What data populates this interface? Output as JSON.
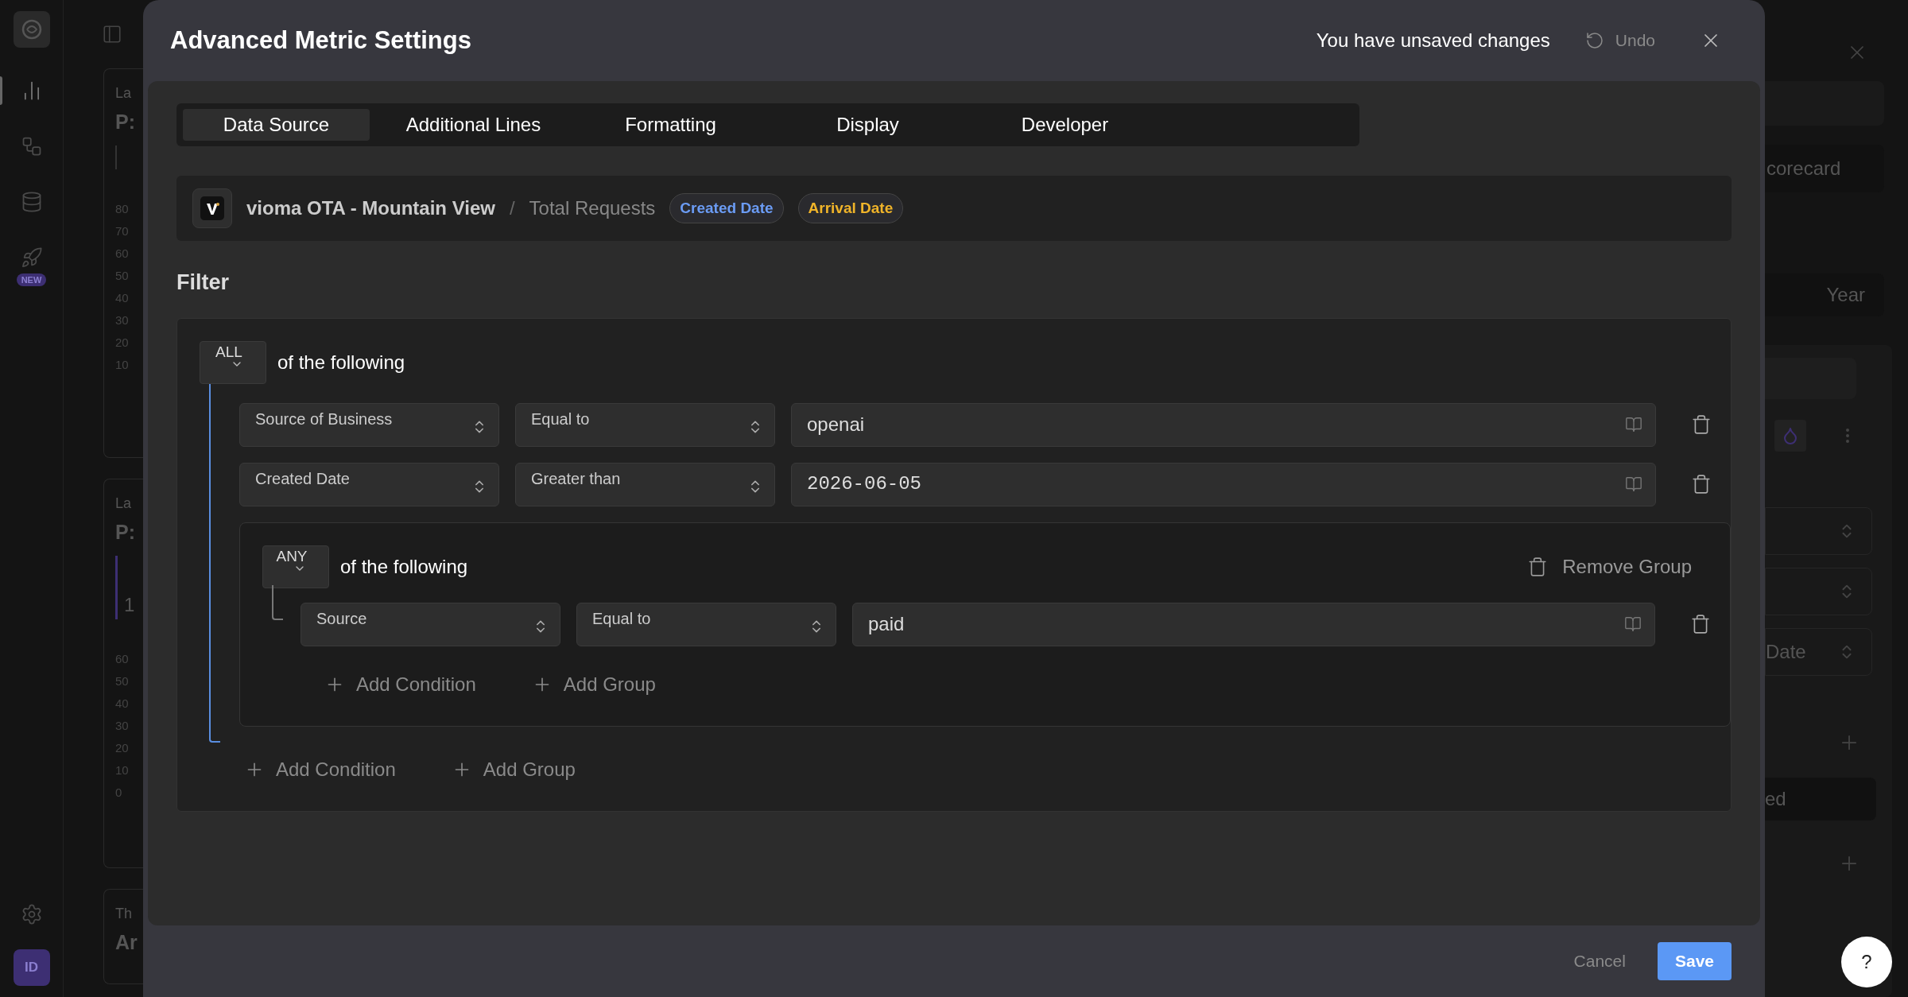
{
  "app_sidebar": {
    "items": [
      {
        "kind": "chart",
        "selected": true
      },
      {
        "kind": "flow",
        "selected": false
      },
      {
        "kind": "database",
        "selected": false
      },
      {
        "kind": "rocket",
        "selected": false,
        "badge": "NEW"
      }
    ],
    "avatar": "ID"
  },
  "background_left": {
    "cards": [
      {
        "label": "La",
        "value": "P:",
        "accent": false,
        "ticks": [
          "80",
          "70",
          "60",
          "50",
          "40",
          "30",
          "20",
          "10"
        ]
      },
      {
        "label": "La",
        "value": "P:",
        "accent": true,
        "accent_value": "1",
        "ticks": [
          "60",
          "50",
          "40",
          "30",
          "20",
          "10",
          "0"
        ]
      },
      {
        "label": "Th",
        "value": "Ar",
        "accent": false
      }
    ]
  },
  "background_right": {
    "button": "corecard",
    "period": "Year",
    "select_value": "Date",
    "status": "ed"
  },
  "dialog": {
    "title": "Advanced Metric Settings",
    "unsaved_notice": "You have unsaved changes",
    "undo": "Undo",
    "tabs": [
      {
        "label": "Data Source",
        "selected": true
      },
      {
        "label": "Additional Lines",
        "selected": false
      },
      {
        "label": "Formatting",
        "selected": false
      },
      {
        "label": "Display",
        "selected": false
      },
      {
        "label": "Developer",
        "selected": false
      }
    ],
    "breadcrumb": {
      "source": "vioma OTA - Mountain View",
      "separator": "/",
      "metric": "Total Requests",
      "tags": [
        {
          "label": "Created Date",
          "color": "#6b9cf5"
        },
        {
          "label": "Arrival Date",
          "color": "#f0b429"
        }
      ]
    },
    "filter": {
      "heading": "Filter",
      "mode": "ALL",
      "suffix": "of the following",
      "items": [
        {
          "kind": "condition",
          "field": "Source of Business",
          "operator": "Equal to",
          "value": "openai",
          "monospace": false
        },
        {
          "kind": "condition",
          "field": "Created Date",
          "operator": "Greater than",
          "value": "2026-06-05",
          "monospace": true
        },
        {
          "kind": "group",
          "mode": "ANY",
          "suffix": "of the following",
          "remove": "Remove Group",
          "items": [
            {
              "kind": "condition",
              "field": "Source",
              "operator": "Equal to",
              "value": "paid",
              "monospace": false
            }
          ],
          "actions": [
            "Add Condition",
            "Add Group"
          ]
        }
      ],
      "actions": [
        "Add Condition",
        "Add Group"
      ]
    },
    "footer": {
      "cancel": "Cancel",
      "save": "Save"
    }
  },
  "help_button": "?"
}
